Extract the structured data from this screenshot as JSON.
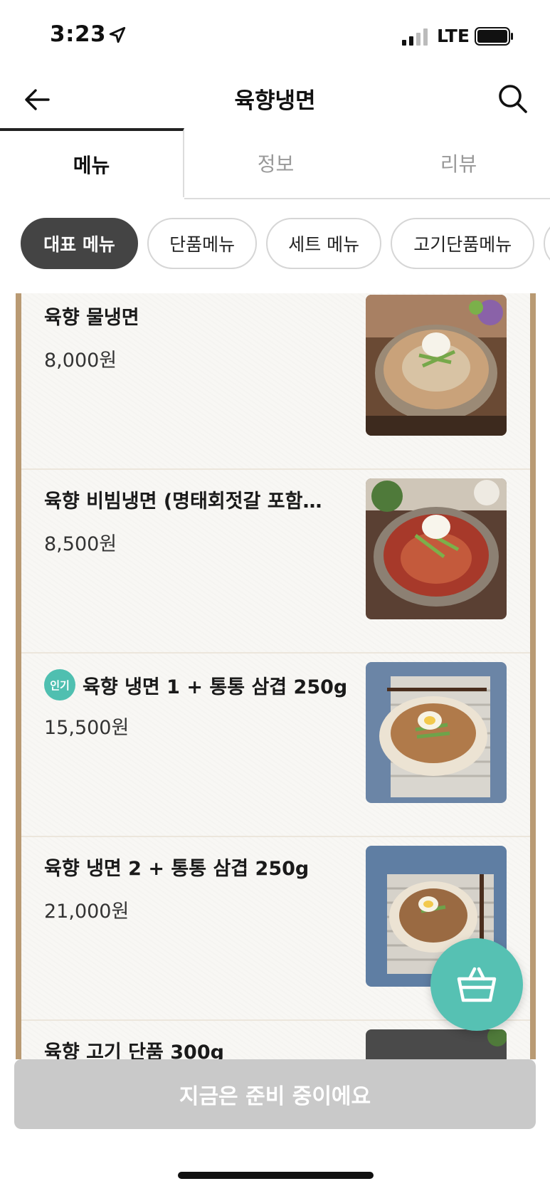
{
  "status_bar": {
    "time": "3:23",
    "network": "LTE"
  },
  "header": {
    "title": "육향냉면"
  },
  "tabs": [
    {
      "label": "메뉴",
      "active": true
    },
    {
      "label": "정보",
      "active": false
    },
    {
      "label": "리뷰",
      "active": false
    }
  ],
  "categories": [
    {
      "label": "대표 메뉴",
      "active": true
    },
    {
      "label": "단품메뉴",
      "active": false
    },
    {
      "label": "세트 메뉴",
      "active": false
    },
    {
      "label": "고기단품메뉴",
      "active": false
    }
  ],
  "menu_items": [
    {
      "name": "육향 물냉면",
      "price": "8,000원",
      "badge": ""
    },
    {
      "name": "육향 비빔냉면 (명태회젓갈 포함…",
      "price": "8,500원",
      "badge": ""
    },
    {
      "name": "육향 냉면 1 + 통통 삼겹 250g",
      "price": "15,500원",
      "badge": "인기"
    },
    {
      "name": "육향 냉면 2 + 통통 삼겹 250g",
      "price": "21,000원",
      "badge": ""
    },
    {
      "name": "육향 고기 단품 300g",
      "price": "",
      "badge": ""
    }
  ],
  "order_button": {
    "label": "지금은 준비 중이에요"
  },
  "colors": {
    "accent": "#56c1b3",
    "chip_active": "#444444",
    "disabled": "#c9c9c9",
    "frame": "#b99a73"
  }
}
